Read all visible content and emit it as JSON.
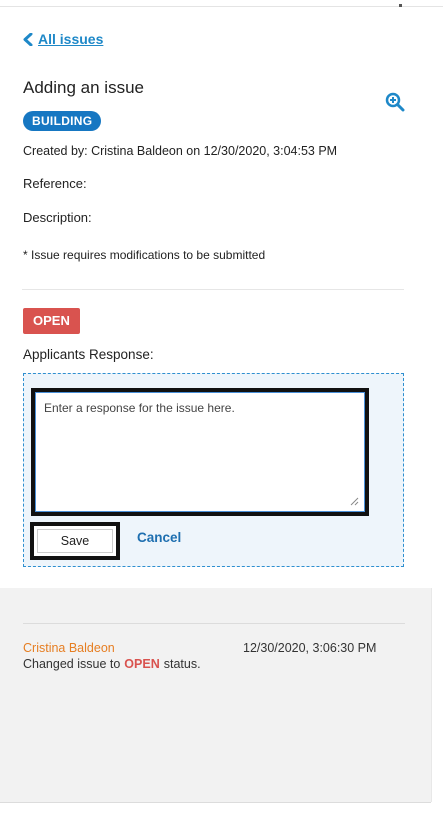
{
  "nav": {
    "back_label": "All issues"
  },
  "issue": {
    "title": "Adding an issue",
    "category_badge": "BUILDING",
    "created_by": "Created by: Cristina Baldeon on 12/30/2020, 3:04:53 PM",
    "reference_label": "Reference:",
    "description_label": "Description:",
    "requirement_note": "* Issue requires modifications to be submitted"
  },
  "status": {
    "label": "OPEN",
    "color": "#d9534f"
  },
  "response": {
    "label": "Applicants Response:",
    "placeholder": "Enter a response for the issue here.",
    "save_label": "Save",
    "cancel_label": "Cancel"
  },
  "history": [
    {
      "author": "Cristina Baldeon",
      "timestamp": "12/30/2020, 3:06:30 PM",
      "text_before": "Changed issue to",
      "status": "OPEN",
      "text_after": "status."
    }
  ],
  "colors": {
    "accent": "#1e88c8",
    "building_badge": "#1677c2",
    "author": "#e67e22"
  },
  "icons": {
    "back": "chevron-left-icon",
    "zoom": "zoom-in-icon"
  }
}
